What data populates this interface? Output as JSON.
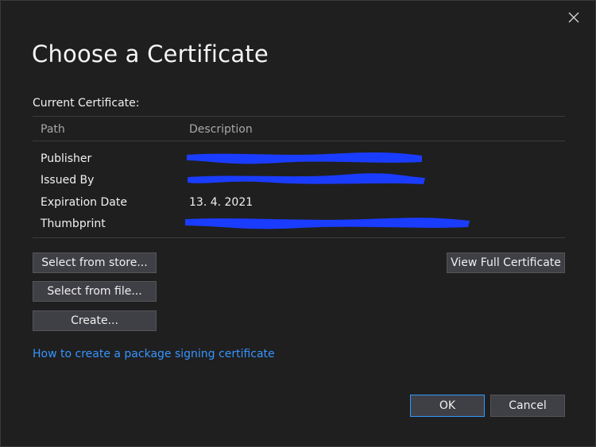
{
  "dialog": {
    "title": "Choose a Certificate",
    "close_icon": "close-icon"
  },
  "current_certificate": {
    "label": "Current Certificate:",
    "columns": [
      "Path",
      "Description"
    ],
    "rows": [
      {
        "key": "Publisher",
        "value": ""
      },
      {
        "key": "Issued By",
        "value": ""
      },
      {
        "key": "Expiration Date",
        "value": "13. 4. 2021"
      },
      {
        "key": "Thumbprint",
        "value": ""
      }
    ]
  },
  "buttons": {
    "select_from_store": "Select from store...",
    "select_from_file": "Select from file...",
    "create": "Create...",
    "view_full_certificate": "View Full Certificate",
    "ok": "OK",
    "cancel": "Cancel"
  },
  "link": {
    "text": "How to create a package signing certificate"
  },
  "colors": {
    "background": "#1f1f1f",
    "button": "#3f3f46",
    "accent": "#3399ff",
    "link": "#3794ff",
    "redaction": "#1a3cff"
  }
}
